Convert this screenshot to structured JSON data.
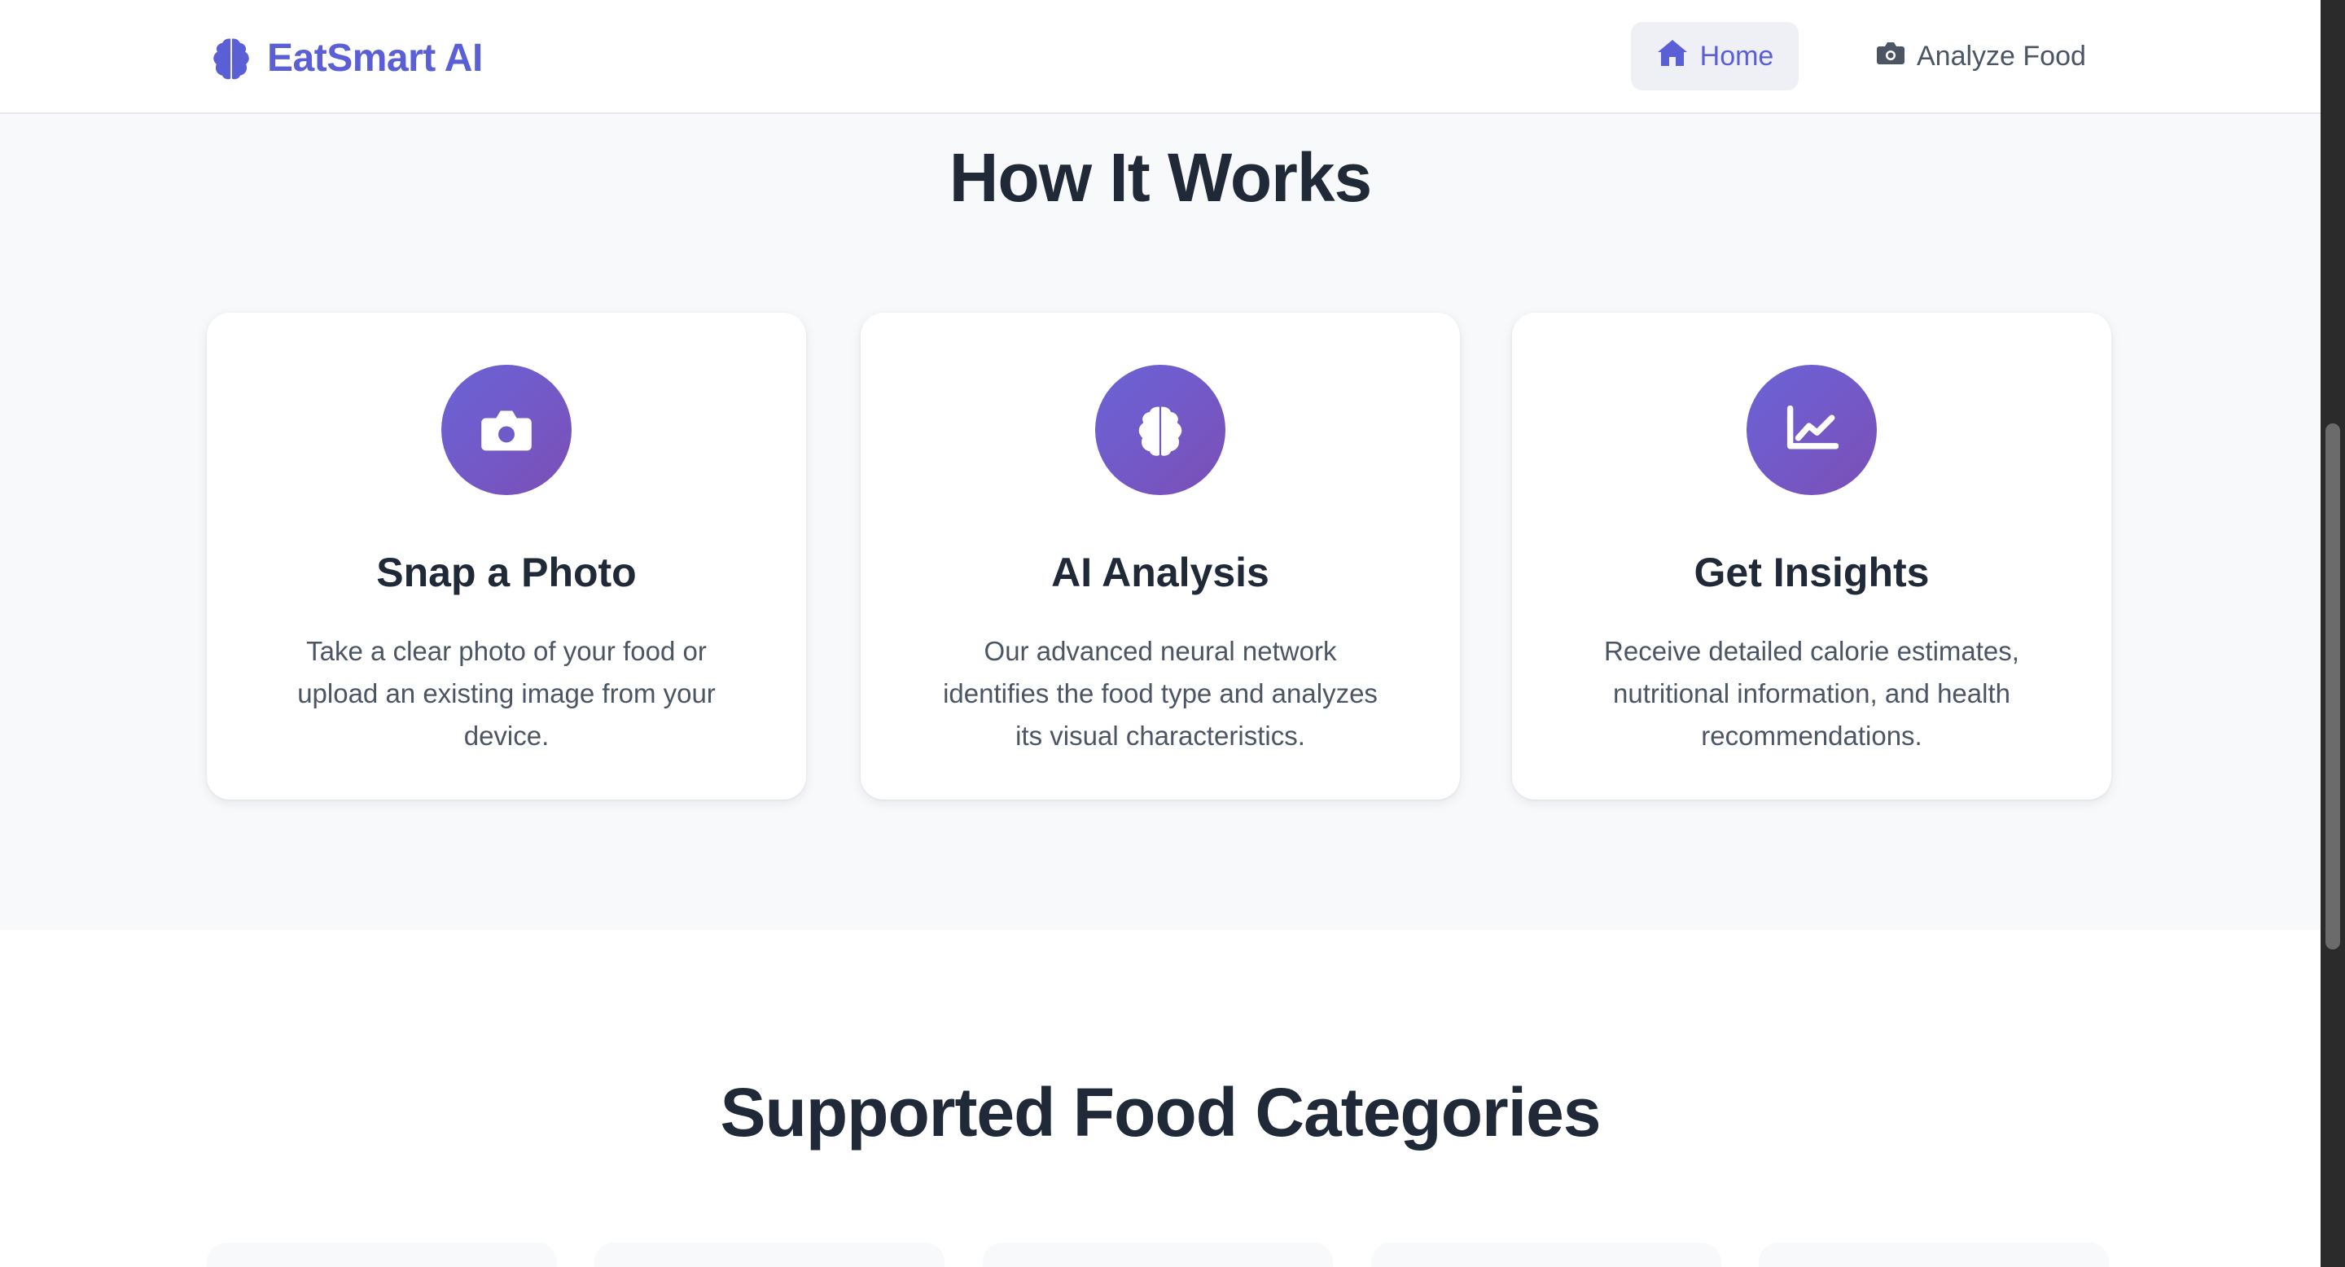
{
  "brand": {
    "name": "EatSmart AI",
    "color": "#5b5fd6",
    "icon": "brain-icon"
  },
  "nav": {
    "items": [
      {
        "label": "Home",
        "icon": "home-icon",
        "active": true
      },
      {
        "label": "Analyze Food",
        "icon": "camera-icon",
        "active": false
      }
    ]
  },
  "how_it_works": {
    "title": "How It Works",
    "cards": [
      {
        "icon": "camera-icon",
        "title": "Snap a Photo",
        "description": "Take a clear photo of your food or upload an existing image from your device."
      },
      {
        "icon": "brain-icon",
        "title": "AI Analysis",
        "description": "Our advanced neural network identifies the food type and analyzes its visual characteristics."
      },
      {
        "icon": "chart-line-icon",
        "title": "Get Insights",
        "description": "Receive detailed calorie estimates, nutritional information, and health recommendations."
      }
    ]
  },
  "categories": {
    "title": "Supported Food Categories"
  },
  "colors": {
    "accent": "#5b5fd6",
    "icon_gradient_start": "#6a63d8",
    "icon_gradient_end": "#7b4fb6",
    "heading": "#1f2937",
    "body_text": "#4b5563"
  }
}
